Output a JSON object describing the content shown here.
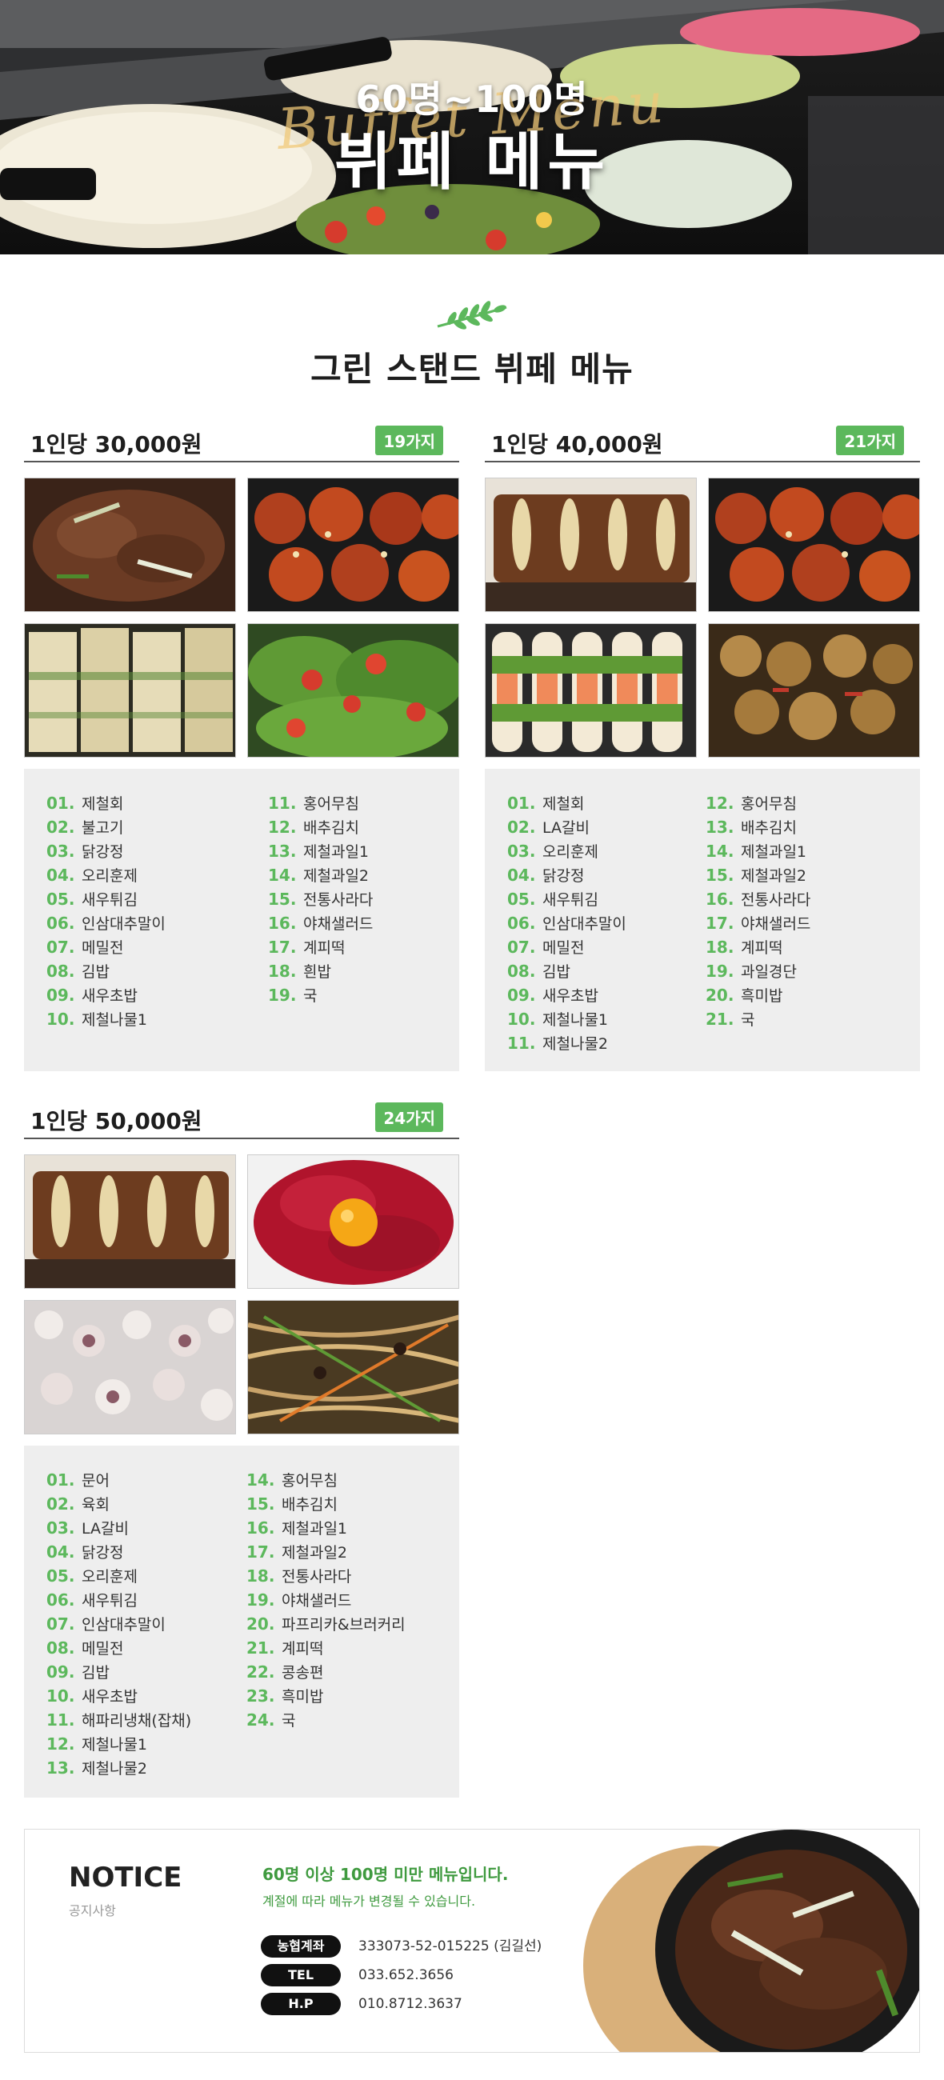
{
  "hero": {
    "subtitle": "60명~100명",
    "title": "뷔페 메뉴",
    "script": "Buffet Menu"
  },
  "section": {
    "title": "그린 스탠드 뷔페 메뉴",
    "leaf_icon": "leaf-icon"
  },
  "colors": {
    "accent": "#5cb85c",
    "notice_text": "#3f9a3f",
    "panel_bg": "#eeeeee"
  },
  "plans": [
    {
      "price": "1인당 30,000원",
      "count": "19가지",
      "photos": [
        "불고기",
        "닭강정",
        "메밀전",
        "야채샐러드"
      ],
      "col1": [
        {
          "num": "01.",
          "name": "제철회"
        },
        {
          "num": "02.",
          "name": "불고기"
        },
        {
          "num": "03.",
          "name": "닭강정"
        },
        {
          "num": "04.",
          "name": "오리훈제"
        },
        {
          "num": "05.",
          "name": "새우튀김"
        },
        {
          "num": "06.",
          "name": "인삼대추말이"
        },
        {
          "num": "07.",
          "name": "메밀전"
        },
        {
          "num": "08.",
          "name": "김밥"
        },
        {
          "num": "09.",
          "name": "새우초밥"
        },
        {
          "num": "10.",
          "name": "제철나물1"
        }
      ],
      "col2": [
        {
          "num": "11.",
          "name": "홍어무침"
        },
        {
          "num": "12.",
          "name": "배추김치"
        },
        {
          "num": "13.",
          "name": "제철과일1"
        },
        {
          "num": "14.",
          "name": "제철과일2"
        },
        {
          "num": "15.",
          "name": "전통사라다"
        },
        {
          "num": "16.",
          "name": "야채샐러드"
        },
        {
          "num": "17.",
          "name": "계피떡"
        },
        {
          "num": "18.",
          "name": "흰밥"
        },
        {
          "num": "19.",
          "name": "국"
        }
      ]
    },
    {
      "price": "1인당 40,000원",
      "count": "21가지",
      "photos": [
        "LA갈비",
        "닭강정",
        "새우초밥",
        "흑미밥"
      ],
      "col1": [
        {
          "num": "01.",
          "name": "제철회"
        },
        {
          "num": "02.",
          "name": "LA갈비"
        },
        {
          "num": "03.",
          "name": "오리훈제"
        },
        {
          "num": "04.",
          "name": "닭강정"
        },
        {
          "num": "05.",
          "name": "새우튀김"
        },
        {
          "num": "06.",
          "name": "인삼대추말이"
        },
        {
          "num": "07.",
          "name": "메밀전"
        },
        {
          "num": "08.",
          "name": "김밥"
        },
        {
          "num": "09.",
          "name": "새우초밥"
        },
        {
          "num": "10.",
          "name": "제철나물1"
        },
        {
          "num": "11.",
          "name": "제철나물2"
        }
      ],
      "col2": [
        {
          "num": "12.",
          "name": "홍어무침"
        },
        {
          "num": "13.",
          "name": "배추김치"
        },
        {
          "num": "14.",
          "name": "제철과일1"
        },
        {
          "num": "15.",
          "name": "제철과일2"
        },
        {
          "num": "16.",
          "name": "전통사라다"
        },
        {
          "num": "17.",
          "name": "야채샐러드"
        },
        {
          "num": "18.",
          "name": "계피떡"
        },
        {
          "num": "19.",
          "name": "과일경단"
        },
        {
          "num": "20.",
          "name": "흑미밥"
        },
        {
          "num": "21.",
          "name": "국"
        }
      ]
    },
    {
      "price": "1인당 50,000원",
      "count": "24가지",
      "photos": [
        "LA갈비",
        "육회",
        "문어",
        "잡채"
      ],
      "col1": [
        {
          "num": "01.",
          "name": "문어"
        },
        {
          "num": "02.",
          "name": "육회"
        },
        {
          "num": "03.",
          "name": "LA갈비"
        },
        {
          "num": "04.",
          "name": "닭강정"
        },
        {
          "num": "05.",
          "name": "오리훈제"
        },
        {
          "num": "06.",
          "name": "새우튀김"
        },
        {
          "num": "07.",
          "name": "인삼대추말이"
        },
        {
          "num": "08.",
          "name": "메밀전"
        },
        {
          "num": "09.",
          "name": "김밥"
        },
        {
          "num": "10.",
          "name": "새우초밥"
        },
        {
          "num": "11.",
          "name": "해파리냉채(잡채)"
        },
        {
          "num": "12.",
          "name": "제철나물1"
        },
        {
          "num": "13.",
          "name": "제철나물2"
        }
      ],
      "col2": [
        {
          "num": "14.",
          "name": "홍어무침"
        },
        {
          "num": "15.",
          "name": "배추김치"
        },
        {
          "num": "16.",
          "name": "제철과일1"
        },
        {
          "num": "17.",
          "name": "제철과일2"
        },
        {
          "num": "18.",
          "name": "전통사라다"
        },
        {
          "num": "19.",
          "name": "야채샐러드"
        },
        {
          "num": "20.",
          "name": "파프리카&브러커리"
        },
        {
          "num": "21.",
          "name": "계피떡"
        },
        {
          "num": "22.",
          "name": "콩송편"
        },
        {
          "num": "23.",
          "name": "흑미밥"
        },
        {
          "num": "24.",
          "name": "국"
        }
      ]
    }
  ],
  "notice": {
    "title": "NOTICE",
    "subtitle": "공지사항",
    "message": "60명 이상 100명 미만 메뉴입니다.",
    "message2": "계절에 따라 메뉴가 변경될 수 있습니다.",
    "contacts": [
      {
        "label": "농협계좌",
        "value": "333073-52-015225 (김길선)"
      },
      {
        "label": "TEL",
        "value": "033.652.3656"
      },
      {
        "label": "H.P",
        "value": "010.8712.3637"
      }
    ]
  }
}
